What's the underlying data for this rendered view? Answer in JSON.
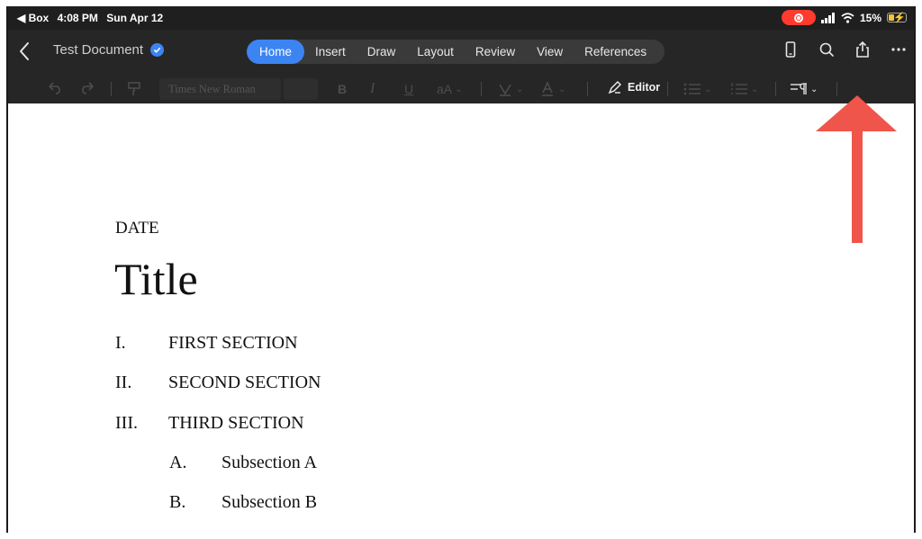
{
  "status_bar": {
    "back_app": "◀ Box",
    "time": "4:08 PM",
    "date": "Sun Apr 12",
    "battery": "15%"
  },
  "header": {
    "doc_title": "Test Document",
    "tabs": [
      {
        "label": "Home",
        "active": true
      },
      {
        "label": "Insert",
        "active": false
      },
      {
        "label": "Draw",
        "active": false
      },
      {
        "label": "Layout",
        "active": false
      },
      {
        "label": "Review",
        "active": false
      },
      {
        "label": "View",
        "active": false
      },
      {
        "label": "References",
        "active": false
      }
    ],
    "accent": "#3c84f2"
  },
  "toolbar": {
    "font_name": "Times New Roman",
    "bold": "B",
    "italic": "I",
    "underline": "U",
    "font_size_icon": "aA",
    "editor_label": "Editor"
  },
  "document": {
    "date": "DATE",
    "title": "Title",
    "sections": [
      {
        "num": "I.",
        "text": "FIRST SECTION"
      },
      {
        "num": "II.",
        "text": "SECOND SECTION"
      },
      {
        "num": "III.",
        "text": "THIRD SECTION"
      }
    ],
    "subsections": [
      {
        "num": "A.",
        "text": "Subsection A"
      },
      {
        "num": "B.",
        "text": "Subsection B"
      }
    ]
  },
  "annotation": {
    "arrow_color": "#f0554b",
    "points_to": "share-icon"
  }
}
